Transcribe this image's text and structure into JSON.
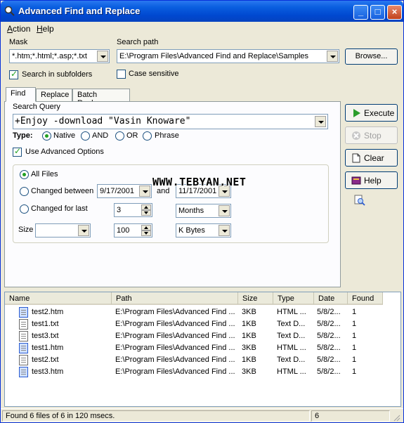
{
  "window": {
    "title": "Advanced Find and Replace"
  },
  "titlebar_buttons": {
    "minimize": "_",
    "maximize": "□",
    "close": "×"
  },
  "menu": [
    {
      "hotkey": "A",
      "rest": "ction"
    },
    {
      "hotkey": "H",
      "rest": "elp"
    }
  ],
  "mask": {
    "label": "Mask",
    "value": "*.htm;*.html;*.asp;*.txt"
  },
  "search_path": {
    "label": "Search path",
    "value": "E:\\Program Files\\Advanced Find and Replace\\Samples"
  },
  "browse_label": "Browse...",
  "search_subfolders": {
    "label": "Search in subfolders",
    "checked": true
  },
  "case_sensitive": {
    "label": "Case sensitive",
    "checked": false
  },
  "tabs": [
    {
      "label": "Find",
      "active": true
    },
    {
      "label": "Replace",
      "active": false
    },
    {
      "label": "Batch Replace",
      "active": false
    }
  ],
  "search_query": {
    "label": "Search Query",
    "value": "+Enjoy -download \"Vasin Knoware\""
  },
  "type": {
    "label": "Type:",
    "options": [
      "Native",
      "AND",
      "OR",
      "Phrase"
    ],
    "selected": "Native"
  },
  "use_advanced": {
    "label": "Use Advanced Options",
    "checked": true
  },
  "advanced": {
    "all_files": "All Files",
    "changed_between": "Changed between",
    "date_from": "9/17/2001",
    "and_label": "and",
    "date_to": "11/17/2001",
    "changed_for_last": "Changed for last",
    "last_value": "3",
    "last_unit": "Months",
    "size_label": "Size",
    "size_op": "",
    "size_value": "100",
    "size_unit": "K Bytes",
    "selected": "All Files"
  },
  "watermark": "WWW.TEBYAN.NET",
  "side_buttons": [
    {
      "label": "Execute",
      "enabled": true,
      "icon": "play-icon"
    },
    {
      "label": "Stop",
      "enabled": false,
      "icon": "stop-icon"
    },
    {
      "label": "Clear",
      "enabled": true,
      "icon": "document-icon"
    },
    {
      "label": "Help",
      "enabled": true,
      "icon": "book-icon"
    }
  ],
  "results": {
    "columns": [
      "Name",
      "Path",
      "Size",
      "Type",
      "Date",
      "Found"
    ],
    "rows": [
      {
        "name": "test2.htm",
        "kind": "htm",
        "path": "E:\\Program Files\\Advanced Find ...",
        "size": "3KB",
        "type": "HTML ...",
        "date": "5/8/2...",
        "found": "1"
      },
      {
        "name": "test1.txt",
        "kind": "txt",
        "path": "E:\\Program Files\\Advanced Find ...",
        "size": "1KB",
        "type": "Text D...",
        "date": "5/8/2...",
        "found": "1"
      },
      {
        "name": "test3.txt",
        "kind": "txt",
        "path": "E:\\Program Files\\Advanced Find ...",
        "size": "1KB",
        "type": "Text D...",
        "date": "5/8/2...",
        "found": "1"
      },
      {
        "name": "test1.htm",
        "kind": "htm",
        "path": "E:\\Program Files\\Advanced Find ...",
        "size": "3KB",
        "type": "HTML ...",
        "date": "5/8/2...",
        "found": "1"
      },
      {
        "name": "test2.txt",
        "kind": "txt",
        "path": "E:\\Program Files\\Advanced Find ...",
        "size": "1KB",
        "type": "Text D...",
        "date": "5/8/2...",
        "found": "1"
      },
      {
        "name": "test3.htm",
        "kind": "htm",
        "path": "E:\\Program Files\\Advanced Find ...",
        "size": "3KB",
        "type": "HTML ...",
        "date": "5/8/2...",
        "found": "1"
      }
    ]
  },
  "status": {
    "message": "Found 6 files of 6 in 120 msecs.",
    "count": "6"
  },
  "colors": {
    "title_blue": "#0a5fe0",
    "face": "#ece9d8",
    "check_green": "#21a121"
  }
}
